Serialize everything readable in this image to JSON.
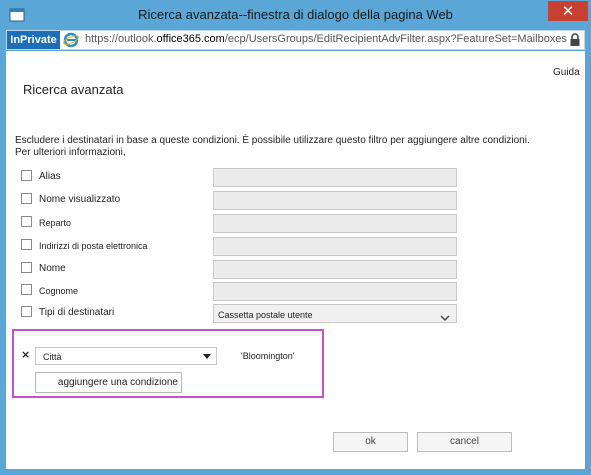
{
  "window": {
    "title": "Ricerca avanzata--finestra di dialogo della pagina Web",
    "close_glyph": "✕"
  },
  "addressbar": {
    "inprivate_label": "InPrivate",
    "url_prefix": "https://outlook.",
    "url_host": "office365.com",
    "url_path": "/ecp/UsersGroups/EditRecipientAdvFilter.aspx?FeatureSet=Mailboxes"
  },
  "dialog": {
    "help_link": "Guida",
    "title": "Ricerca avanzata",
    "description_line1": "Escludere i destinatari in base a queste condizioni. È possibile utilizzare questo filtro per aggiungere altre condizioni.",
    "description_line2": "Per ulteriori informazioni,",
    "fields": [
      {
        "label": "Alias",
        "value": ""
      },
      {
        "label": "Nome visualizzato",
        "value": ""
      },
      {
        "label": "Reparto",
        "value": ""
      },
      {
        "label": "Indirizzi di posta elettronica",
        "value": ""
      },
      {
        "label": "Nome",
        "value": ""
      },
      {
        "label": "Cognome",
        "value": ""
      }
    ],
    "recipient_type": {
      "label": "Tipi di destinatari",
      "selected": "Cassetta postale utente"
    },
    "condition": {
      "remove_glyph": "×",
      "field_selected": "Città",
      "value": "'Bloomington'",
      "add_button": "aggiungere una condizione"
    },
    "ok_button": "ok",
    "cancel_button": "cancel"
  },
  "colors": {
    "window_frame": "#5aa6d6",
    "inprivate": "#1c6fb4",
    "close": "#c84031",
    "highlight_border": "#c64fd4"
  }
}
